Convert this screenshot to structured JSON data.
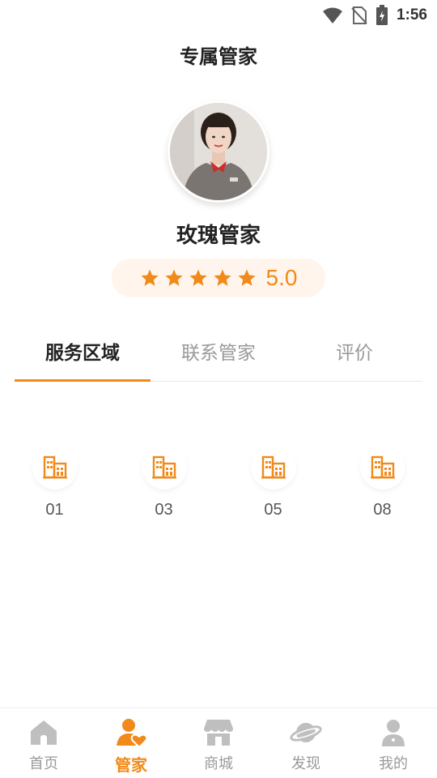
{
  "status_bar": {
    "time": "1:56"
  },
  "page": {
    "title": "专属管家"
  },
  "butler": {
    "name": "玫瑰管家",
    "rating": "5.0",
    "stars": 5
  },
  "tabs": [
    {
      "label": "服务区域",
      "active": true
    },
    {
      "label": "联系管家",
      "active": false
    },
    {
      "label": "评价",
      "active": false
    }
  ],
  "service_areas": [
    {
      "label": "01"
    },
    {
      "label": "03"
    },
    {
      "label": "05"
    },
    {
      "label": "08"
    }
  ],
  "bottom_nav": [
    {
      "label": "首页",
      "icon": "home-icon",
      "active": false
    },
    {
      "label": "管家",
      "icon": "butler-icon",
      "active": true
    },
    {
      "label": "商城",
      "icon": "store-icon",
      "active": false
    },
    {
      "label": "发现",
      "icon": "planet-icon",
      "active": false
    },
    {
      "label": "我的",
      "icon": "profile-icon",
      "active": false
    }
  ],
  "colors": {
    "accent": "#f08a1a",
    "star": "#f08a1a",
    "muted": "#999999",
    "rating_bg": "#fff5ec"
  }
}
